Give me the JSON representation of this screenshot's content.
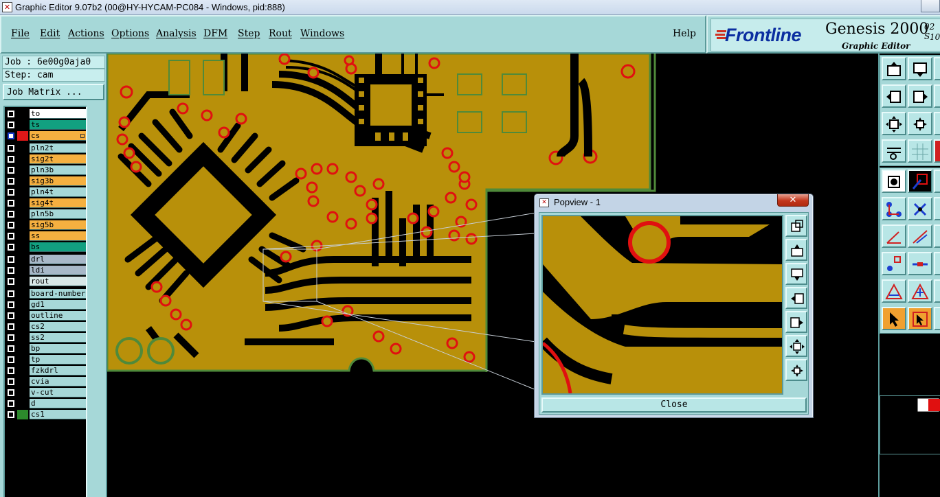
{
  "window": {
    "title": "Graphic Editor 9.07b2 (00@HY-HYCAM-PC084 - Windows, pid:888)"
  },
  "menu": {
    "items": [
      "File",
      "Edit",
      "Actions",
      "Options",
      "Analysis",
      "DFM",
      "Step",
      "Rout",
      "Windows"
    ],
    "help": "Help"
  },
  "logo": {
    "brand": "Frontline",
    "product": "Genesis 2000",
    "subtitle": "Graphic Editor",
    "version_top": "02 S",
    "version_bottom": "10"
  },
  "job": {
    "job_line": "Job : 6e00g0aja0",
    "step_line": "Step: cam",
    "matrix_button": "Job Matrix ..."
  },
  "layers": [
    {
      "name": "to",
      "color": "#ffffff",
      "swatch": "#000000",
      "active": false
    },
    {
      "name": "ts",
      "color": "#12a080",
      "swatch": "#000000",
      "active": false
    },
    {
      "name": "cs",
      "color": "#f5b040",
      "swatch": "#e01818",
      "active": true
    },
    {
      "name": "pln2t",
      "color": "#a6d8d8",
      "swatch": "#000000",
      "active": false
    },
    {
      "name": "sig2t",
      "color": "#f5b040",
      "swatch": "#000000",
      "active": false
    },
    {
      "name": "pln3b",
      "color": "#a6d8d8",
      "swatch": "#000000",
      "active": false
    },
    {
      "name": "sig3b",
      "color": "#f5b040",
      "swatch": "#000000",
      "active": false
    },
    {
      "name": "pln4t",
      "color": "#a6d8d8",
      "swatch": "#000000",
      "active": false
    },
    {
      "name": "sig4t",
      "color": "#f5b040",
      "swatch": "#000000",
      "active": false
    },
    {
      "name": "pln5b",
      "color": "#a6d8d8",
      "swatch": "#000000",
      "active": false
    },
    {
      "name": "sig5b",
      "color": "#f5b040",
      "swatch": "#000000",
      "active": false
    },
    {
      "name": "ss",
      "color": "#f5b040",
      "swatch": "#000000",
      "active": false
    },
    {
      "name": "bs",
      "color": "#12a080",
      "swatch": "#000000",
      "active": false
    },
    {
      "name": "drl",
      "color": "#a8b8c8",
      "swatch": "#000000",
      "active": false
    },
    {
      "name": "ldi",
      "color": "#a8b8c8",
      "swatch": "#000000",
      "active": false
    },
    {
      "name": "rout",
      "color": "#d8e8e8",
      "swatch": "#000000",
      "active": false
    },
    {
      "name": "board-number",
      "color": "#a6d8d8",
      "swatch": "#000000",
      "active": false
    },
    {
      "name": "gd1",
      "color": "#a6d8d8",
      "swatch": "#000000",
      "active": false
    },
    {
      "name": "outline",
      "color": "#a6d8d8",
      "swatch": "#000000",
      "active": false
    },
    {
      "name": "cs2",
      "color": "#a6d8d8",
      "swatch": "#000000",
      "active": false
    },
    {
      "name": "ss2",
      "color": "#a6d8d8",
      "swatch": "#000000",
      "active": false
    },
    {
      "name": "bp",
      "color": "#a6d8d8",
      "swatch": "#000000",
      "active": false
    },
    {
      "name": "tp",
      "color": "#a6d8d8",
      "swatch": "#000000",
      "active": false
    },
    {
      "name": "fzkdrl",
      "color": "#a6d8d8",
      "swatch": "#000000",
      "active": false
    },
    {
      "name": "cvia",
      "color": "#a6d8d8",
      "swatch": "#000000",
      "active": false
    },
    {
      "name": "v-cut",
      "color": "#a6d8d8",
      "swatch": "#000000",
      "active": false
    },
    {
      "name": "d",
      "color": "#a6d8d8",
      "swatch": "#000000",
      "active": false
    },
    {
      "name": "cs1",
      "color": "#a6d8d8",
      "swatch": "#2c8a2c",
      "active": false
    }
  ],
  "popview": {
    "title": "Popview - 1",
    "close_x": "✕",
    "close_button": "Close"
  },
  "colors": {
    "copper": "#b8900a",
    "pad_ring": "#e01010",
    "outline": "#4f8a3a",
    "panel": "#a6d8d8"
  },
  "icons": {
    "app": "graphic-editor-icon",
    "toolbar": [
      "zoom-up-icon",
      "zoom-down-icon",
      "pan-left-icon",
      "pan-right-icon",
      "fit-icon",
      "center-icon",
      "measure-icon",
      "grid-icon",
      "snap-icon",
      "highlight-icon",
      "net-icon",
      "cross-icon",
      "angle-icon",
      "line-icon",
      "select-icon",
      "move-icon",
      "triangle-icon",
      "triangle-red-icon",
      "pointer-icon",
      "pointer-red-icon"
    ]
  }
}
